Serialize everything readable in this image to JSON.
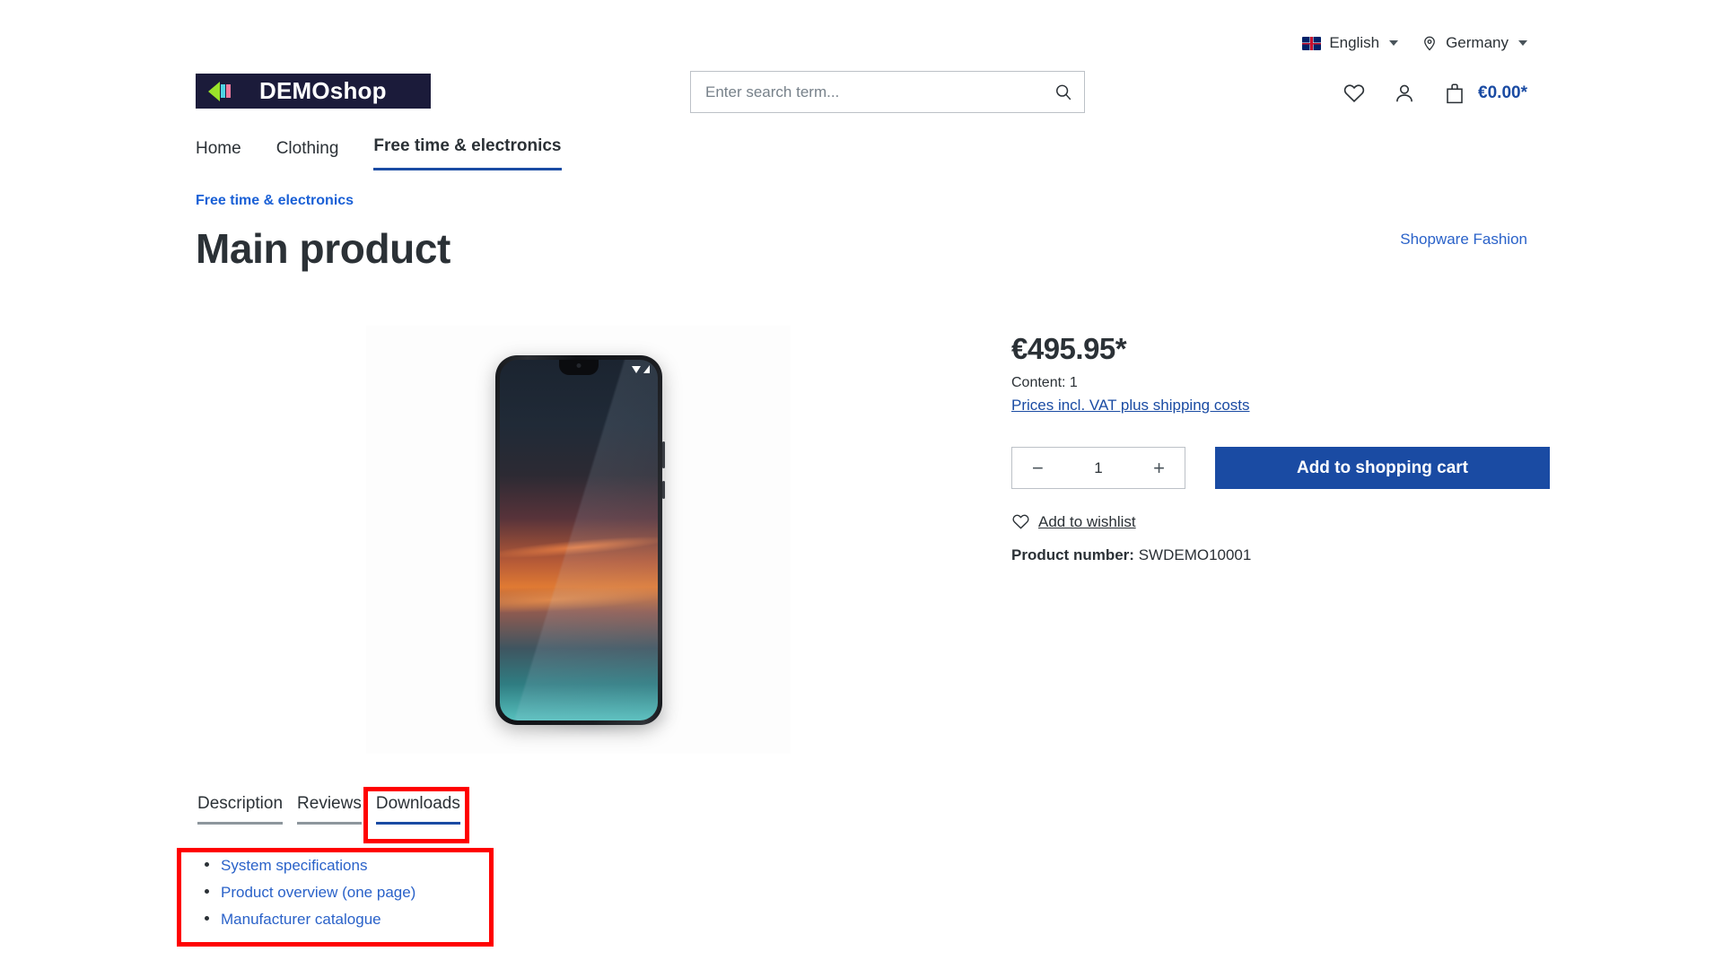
{
  "topbar": {
    "language": {
      "label": "English",
      "icon": "uk-flag-icon"
    },
    "country": {
      "label": "Germany",
      "icon": "location-pin-icon"
    }
  },
  "header": {
    "logo_text": "DEMOshop",
    "search": {
      "placeholder": "Enter search term...",
      "value": ""
    },
    "actions": {
      "wishlist_icon": "heart-icon",
      "account_icon": "user-icon",
      "cart_icon": "bag-icon",
      "cart_total": "€0.00*"
    }
  },
  "nav": {
    "items": [
      {
        "label": "Home",
        "active": false
      },
      {
        "label": "Clothing",
        "active": false
      },
      {
        "label": "Free time & electronics",
        "active": true
      }
    ]
  },
  "product": {
    "breadcrumb": "Free time & electronics",
    "title": "Main product",
    "manufacturer": "Shopware Fashion",
    "price": "€495.95*",
    "content_line": "Content: 1",
    "vat_link": "Prices incl. VAT plus shipping costs",
    "quantity": "1",
    "decrease_label": "−",
    "increase_label": "+",
    "add_to_cart_label": "Add to shopping cart",
    "wishlist_label": "Add to wishlist",
    "product_number_label": "Product number:",
    "product_number_value": "SWDEMO10001",
    "image_alt": "smartphone-product-image"
  },
  "tabs": [
    {
      "label": "Description",
      "active": false
    },
    {
      "label": "Reviews",
      "active": false
    },
    {
      "label": "Downloads",
      "active": true
    }
  ],
  "downloads": {
    "items": [
      {
        "label": "System specifications"
      },
      {
        "label": "Product overview (one page)"
      },
      {
        "label": "Manufacturer catalogue"
      }
    ]
  },
  "colors": {
    "brand_blue": "#1a4ba3",
    "link_blue": "#2a62c9",
    "text_dark": "#2b3136",
    "highlight_red": "#ff0000",
    "logo_bg": "#1b1b3a"
  }
}
